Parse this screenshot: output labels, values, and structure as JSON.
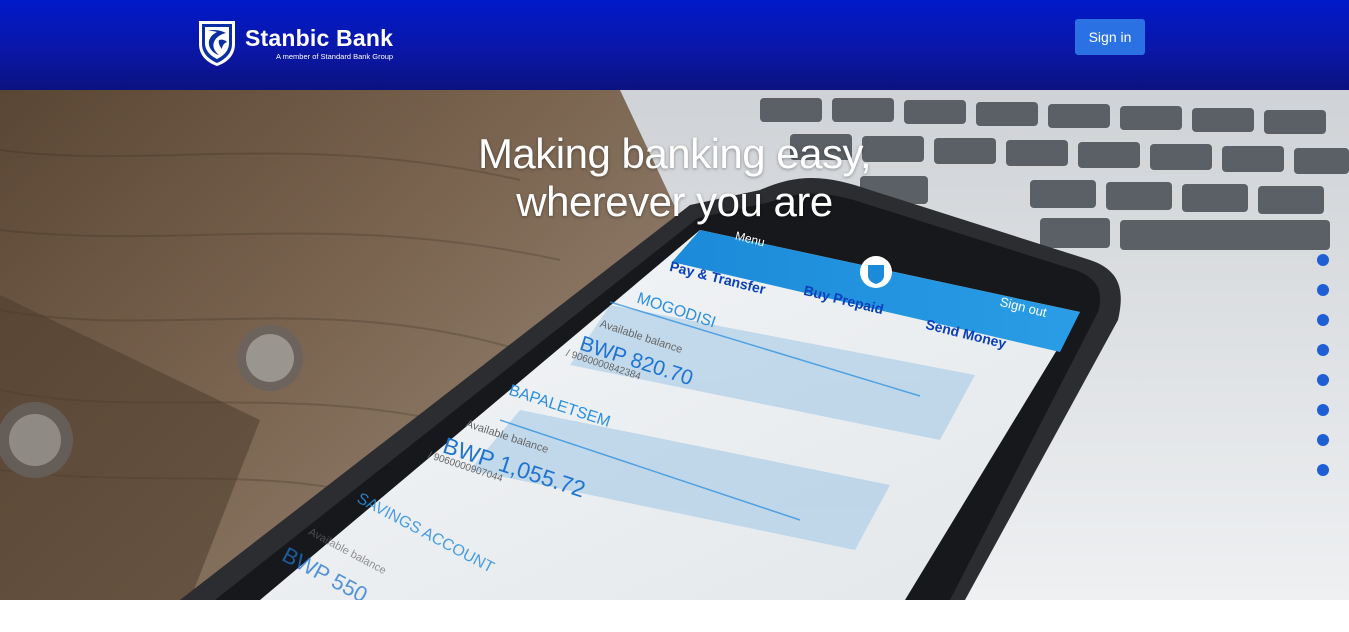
{
  "brand": {
    "name": "Stanbic Bank",
    "tagline": "A member of Standard Bank Group"
  },
  "header": {
    "signin_label": "Sign in"
  },
  "hero": {
    "title_line1": "Making banking easy,",
    "title_line2": "wherever you are",
    "carousel_slide_count": 8
  },
  "phone_app": {
    "menu_label": "Menu",
    "nav": {
      "pay_transfer": "Pay & Transfer",
      "buy_prepaid": "Buy Prepaid",
      "sign_out": "Sign out",
      "send_money": "Send Money"
    },
    "accounts": [
      {
        "name": "MOGODISI",
        "balance_label": "Available balance",
        "balance": "BWP 820.70",
        "number": "/ 9060000842384"
      },
      {
        "name": "BAPALETSEM",
        "balance_label": "Available balance",
        "balance": "BWP 1,055.72",
        "number": "/ 9060000907044"
      },
      {
        "name": "SAVINGS ACCOUNT",
        "balance_label": "Available balance",
        "balance": "BWP 550.",
        "number": ""
      }
    ]
  },
  "colors": {
    "header_top": "#0019c9",
    "header_bottom": "#0b1280",
    "button": "#2a72e3",
    "dot": "#1f5fd6"
  },
  "icons": {
    "logo": "stanbic-shield-logo",
    "carousel": "carousel-dot"
  }
}
